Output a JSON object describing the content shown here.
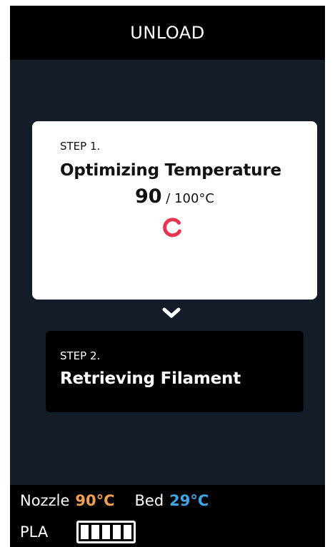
{
  "header": {
    "title": "UNLOAD"
  },
  "step1": {
    "label": "STEP 1.",
    "title": "Optimizing Temperature",
    "current_temp": "90",
    "separator": " / ",
    "target_temp": "100°C",
    "status": "in-progress"
  },
  "step2": {
    "label": "STEP 2.",
    "title": "Retrieving Filament",
    "status": "pending"
  },
  "status_bar": {
    "nozzle_label": "Nozzle",
    "nozzle_value": "90°C",
    "bed_label": "Bed",
    "bed_value": "29°C",
    "material": "PLA",
    "filament_segments": 5,
    "filament_level": 1.0
  },
  "colors": {
    "background": "#141c28",
    "spinner": "#e8344e",
    "nozzle": "#f0a04b",
    "bed": "#3fa5e6"
  },
  "icons": {
    "spinner": "loading-spinner-icon",
    "chevron": "chevron-down-icon",
    "filament": "filament-level-icon"
  }
}
